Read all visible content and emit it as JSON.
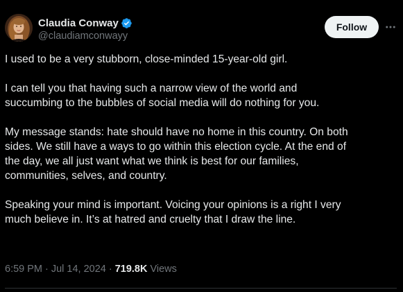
{
  "author": {
    "display_name": "Claudia Conway",
    "handle": "@claudiamconwayy",
    "verified": true,
    "verified_color": "#1d9bf0",
    "avatar_icon": "profile-photo"
  },
  "actions": {
    "follow_label": "Follow",
    "more_icon": "more-horizontal-icon"
  },
  "tweet": {
    "paragraphs": [
      "I used to be a very stubborn, close-minded 15-year-old girl.",
      "I can tell you that having such a narrow view of the world and\nsuccumbing to the bubbles of social media will do nothing for you.",
      "My message stands: hate should have no home in this country. On both\nsides. We still have a ways to go within this election cycle. At the end of\nthe day, we all just want what we think is best for our families,\ncommunities, selves, and country.",
      "Speaking your mind is important. Voicing your opinions is a right I very\nmuch believe in. It’s at hatred and cruelty that I draw the line."
    ],
    "time": "6:59 PM",
    "date": "Jul 14, 2024",
    "separator": "·",
    "views_count": "719.8K",
    "views_label": "Views"
  },
  "colors": {
    "background": "#000000",
    "text_primary": "#e7e9ea",
    "text_secondary": "#71767b",
    "follow_bg": "#eff3f4",
    "divider": "#2f3336"
  }
}
